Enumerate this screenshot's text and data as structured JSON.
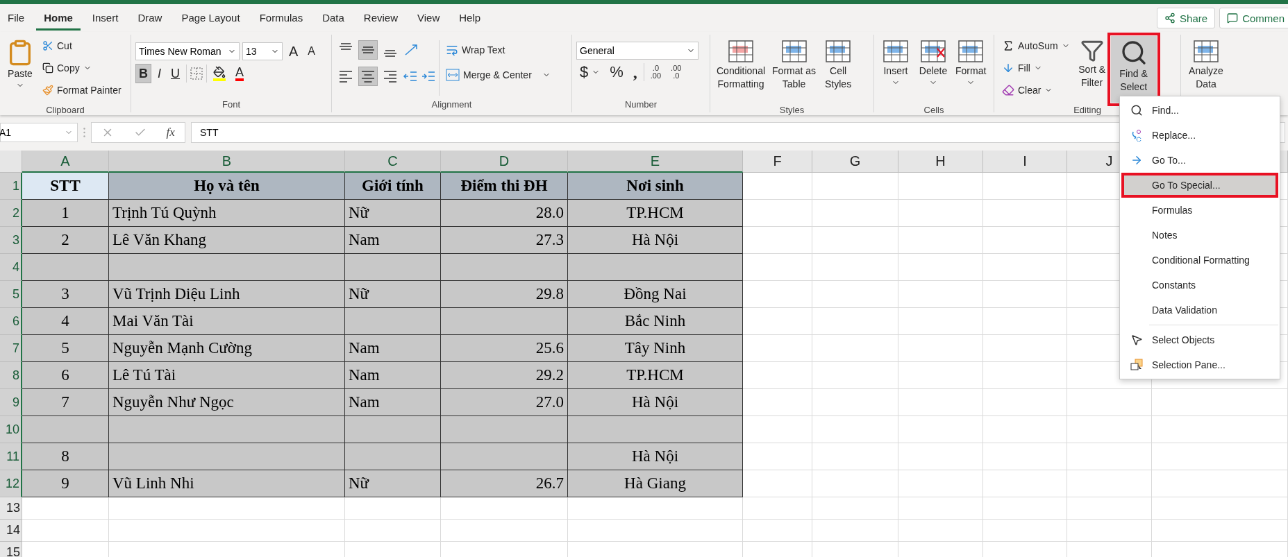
{
  "tabs": [
    {
      "label": "File",
      "selected": false
    },
    {
      "label": "Home",
      "selected": true
    },
    {
      "label": "Insert",
      "selected": false
    },
    {
      "label": "Draw",
      "selected": false
    },
    {
      "label": "Page Layout",
      "selected": false
    },
    {
      "label": "Formulas",
      "selected": false
    },
    {
      "label": "Data",
      "selected": false
    },
    {
      "label": "Review",
      "selected": false
    },
    {
      "label": "View",
      "selected": false
    },
    {
      "label": "Help",
      "selected": false
    }
  ],
  "account": {
    "share": "Share",
    "comments": "Commen"
  },
  "ribbon": {
    "clipboard": {
      "label": "Clipboard",
      "paste": "Paste",
      "cut": "Cut",
      "copy": "Copy",
      "format_painter": "Format Painter"
    },
    "font": {
      "label": "Font",
      "name": "Times New Roman",
      "size": "13",
      "grow": "A",
      "shrink": "A",
      "styles": [
        {
          "text": "B",
          "on": true
        },
        {
          "text": "I",
          "on": false
        },
        {
          "text": "U",
          "on": false
        }
      ],
      "font_color": "A"
    },
    "alignment": {
      "label": "Alignment",
      "vertical": [
        {
          "selected": false
        },
        {
          "selected": true
        },
        {
          "selected": false
        }
      ],
      "horizontal": [
        {
          "selected": false
        },
        {
          "selected": true
        },
        {
          "selected": false
        }
      ],
      "wrap_text": "Wrap Text",
      "merge": "Merge & Center"
    },
    "number": {
      "label": "Number",
      "format": "General",
      "currency": "$",
      "percent": "%",
      "comma": ",",
      "increase_decimal": [
        ".0",
        ".00"
      ],
      "decrease_decimal": [
        ".00",
        ".0"
      ]
    },
    "styles": {
      "label": "Styles",
      "buttons": [
        [
          "Conditional",
          "Formatting"
        ],
        [
          "Format as",
          "Table"
        ],
        [
          "Cell",
          "Styles"
        ]
      ]
    },
    "cells": {
      "label": "Cells",
      "buttons": [
        "Insert",
        "Delete",
        "Format"
      ]
    },
    "editing": {
      "label": "Editing",
      "autosum": "AutoSum",
      "fill": "Fill",
      "clear": "Clear",
      "sort_filter": [
        "Sort &",
        "Filter"
      ],
      "find_select": {
        "lines": [
          "Find &",
          "Select"
        ],
        "pressed": true,
        "highlighted": true
      }
    },
    "analyze": [
      "Analyze",
      "Data"
    ]
  },
  "formula_bar": {
    "name_box": "A1",
    "fx": "fx",
    "value": "STT"
  },
  "sheet": {
    "columns": [
      {
        "label": "A",
        "selected": true
      },
      {
        "label": "B",
        "selected": true
      },
      {
        "label": "C",
        "selected": true
      },
      {
        "label": "D",
        "selected": true
      },
      {
        "label": "E",
        "selected": true
      },
      {
        "label": "F",
        "selected": false
      },
      {
        "label": "G",
        "selected": false
      },
      {
        "label": "H",
        "selected": false
      },
      {
        "label": "I",
        "selected": false
      },
      {
        "label": "J",
        "selected": false
      }
    ],
    "rows": [
      {
        "number": "1",
        "selected": true,
        "kind": "header",
        "cells": [
          {
            "text": "STT",
            "active": true
          },
          {
            "text": "Họ và tên"
          },
          {
            "text": "Giới tính"
          },
          {
            "text": "Điểm thi ĐH"
          },
          {
            "text": "Nơi sinh"
          }
        ]
      },
      {
        "number": "2",
        "selected": true,
        "kind": "data",
        "cells": [
          {
            "text": "1"
          },
          {
            "text": "Trịnh Tú Quỳnh"
          },
          {
            "text": "Nữ"
          },
          {
            "text": "28.0"
          },
          {
            "text": "TP.HCM"
          }
        ]
      },
      {
        "number": "3",
        "selected": true,
        "kind": "data",
        "cells": [
          {
            "text": "2"
          },
          {
            "text": "Lê Văn Khang"
          },
          {
            "text": "Nam"
          },
          {
            "text": "27.3"
          },
          {
            "text": "Hà Nội"
          }
        ]
      },
      {
        "number": "4",
        "selected": true,
        "kind": "data",
        "cells": [
          {},
          {},
          {},
          {},
          {}
        ]
      },
      {
        "number": "5",
        "selected": true,
        "kind": "data",
        "cells": [
          {
            "text": "3"
          },
          {
            "text": "Vũ Trịnh Diệu Linh"
          },
          {
            "text": "Nữ"
          },
          {
            "text": "29.8"
          },
          {
            "text": "Đồng Nai"
          }
        ]
      },
      {
        "number": "6",
        "selected": true,
        "kind": "data",
        "cells": [
          {
            "text": "4"
          },
          {
            "text": "Mai Văn Tài"
          },
          {},
          {},
          {
            "text": "Bắc Ninh"
          }
        ]
      },
      {
        "number": "7",
        "selected": true,
        "kind": "data",
        "cells": [
          {
            "text": "5"
          },
          {
            "text": "Nguyễn Mạnh Cường"
          },
          {
            "text": "Nam"
          },
          {
            "text": "25.6"
          },
          {
            "text": "Tây Ninh"
          }
        ]
      },
      {
        "number": "8",
        "selected": true,
        "kind": "data",
        "cells": [
          {
            "text": "6"
          },
          {
            "text": "Lê Tú Tài"
          },
          {
            "text": "Nam"
          },
          {
            "text": "29.2"
          },
          {
            "text": "TP.HCM"
          }
        ]
      },
      {
        "number": "9",
        "selected": true,
        "kind": "data",
        "cells": [
          {
            "text": "7"
          },
          {
            "text": "Nguyễn Như Ngọc"
          },
          {
            "text": "Nam"
          },
          {
            "text": "27.0"
          },
          {
            "text": "Hà Nội"
          }
        ]
      },
      {
        "number": "10",
        "selected": true,
        "kind": "data",
        "cells": [
          {},
          {},
          {},
          {},
          {}
        ]
      },
      {
        "number": "11",
        "selected": true,
        "kind": "data",
        "cells": [
          {
            "text": "8"
          },
          {},
          {},
          {},
          {
            "text": "Hà Nội"
          }
        ]
      },
      {
        "number": "12",
        "selected": true,
        "kind": "data",
        "cells": [
          {
            "text": "9"
          },
          {
            "text": "Vũ Linh Nhi"
          },
          {
            "text": "Nữ"
          },
          {
            "text": "26.7"
          },
          {
            "text": "Hà Giang"
          }
        ]
      },
      {
        "number": "13",
        "selected": false,
        "kind": "blank"
      },
      {
        "number": "14",
        "selected": false,
        "kind": "blank"
      },
      {
        "number": "15",
        "selected": false,
        "kind": "blank"
      }
    ]
  },
  "find_menu": {
    "groups": [
      [
        {
          "label": "Find...",
          "selected": false,
          "highlighted": false
        },
        {
          "label": "Replace...",
          "selected": false,
          "highlighted": false
        },
        {
          "label": "Go To...",
          "selected": false,
          "highlighted": false
        },
        {
          "label": "Go To Special...",
          "selected": true,
          "highlighted": true
        },
        {
          "label": "Formulas",
          "selected": false,
          "highlighted": false
        },
        {
          "label": "Notes",
          "selected": false,
          "highlighted": false
        },
        {
          "label": "Conditional Formatting",
          "selected": false,
          "highlighted": false
        },
        {
          "label": "Constants",
          "selected": false,
          "highlighted": false
        },
        {
          "label": "Data Validation",
          "selected": false,
          "highlighted": false
        }
      ],
      [
        {
          "label": "Select Objects",
          "selected": false,
          "highlighted": false
        },
        {
          "label": "Selection Pane...",
          "selected": false,
          "highlighted": false
        }
      ]
    ]
  }
}
